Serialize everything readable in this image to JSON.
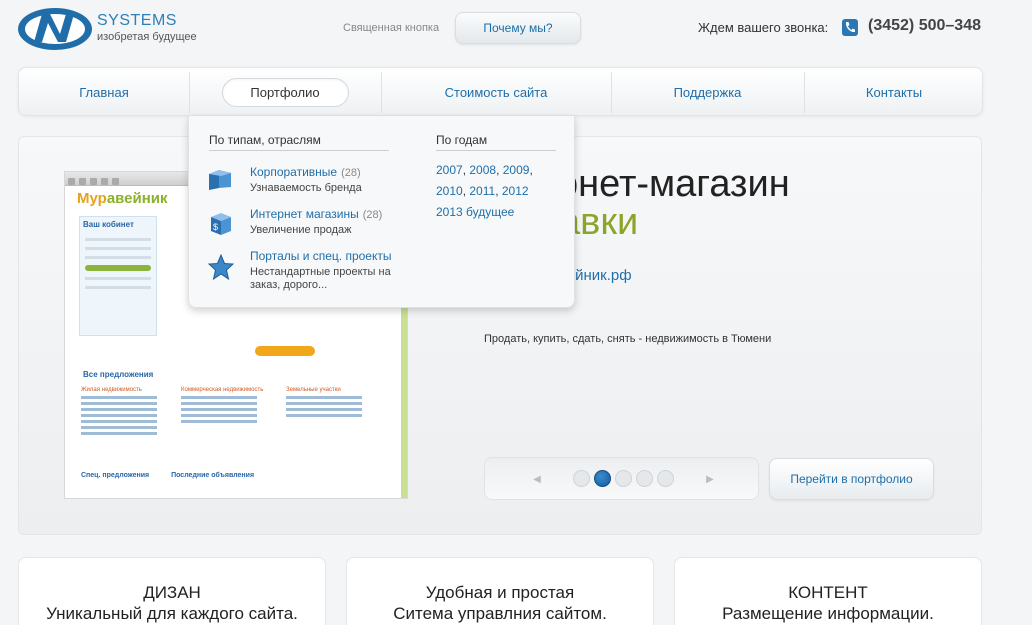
{
  "header": {
    "brand_name": "SYSTEMS",
    "slogan": "изобретая будущее",
    "secret_label": "Священная кнопка",
    "why_button": "Почему мы?",
    "call_label": "Ждем вашего звонка:",
    "phone": "(3452) 500–348"
  },
  "nav": {
    "items": [
      "Главная",
      "Портфолио",
      "Стоимость сайта",
      "Поддержка",
      "Контакты"
    ],
    "active": "Портфолио"
  },
  "dropdown": {
    "by_type_heading": "По типам, отраслям",
    "by_year_heading": "По годам",
    "types": [
      {
        "title": "Корпоративные",
        "count": "(28)",
        "desc": "Узнаваемость бренда",
        "icon": "building-blocks-icon"
      },
      {
        "title": "Интернет магазины",
        "count": "(28)",
        "desc": "Увеличение продаж",
        "icon": "cube-dollar-icon"
      },
      {
        "title": "Порталы и спец. проекты",
        "count": "",
        "desc": "Нестандартные проекты на заказ, дорого...",
        "icon": "star-icon"
      }
    ],
    "years": {
      "row1": [
        "2007",
        "2008",
        "2009"
      ],
      "row2": [
        "2010",
        "2011",
        "2012"
      ],
      "row3": "2013 будущее"
    }
  },
  "hero": {
    "title_1": "рнет-магазин",
    "title_2": "авки",
    "link": "вейник.рф",
    "description": "Продать, купить, сдать, снять - недвижимость в Тюмени",
    "portfolio_button": "Перейти в портфолио",
    "pager": {
      "total": 5,
      "active_index": 1
    },
    "screenshot": {
      "logo_a": "Мур",
      "logo_b": "авейник",
      "sidebar_title": "Ваш кобинет",
      "heading": "Все предложения",
      "col1": "Жилая недвижимость",
      "col2": "Коммерческая недвижимость",
      "col3": "Земельные участки",
      "footer_left": "Спец. предложения",
      "footer_right": "Последние объявления"
    }
  },
  "cards": [
    {
      "title": "ДИЗАН",
      "sub": "Уникальный для каждого сайта."
    },
    {
      "title": "Удобная и простая",
      "sub": "Ситема управлния сайтом."
    },
    {
      "title": "КОНТЕНТ",
      "sub": "Размещение информации."
    }
  ],
  "colors": {
    "accent_blue": "#1f6ea9",
    "accent_green": "#8ba52a",
    "dot_active": "#1a6bb0"
  }
}
